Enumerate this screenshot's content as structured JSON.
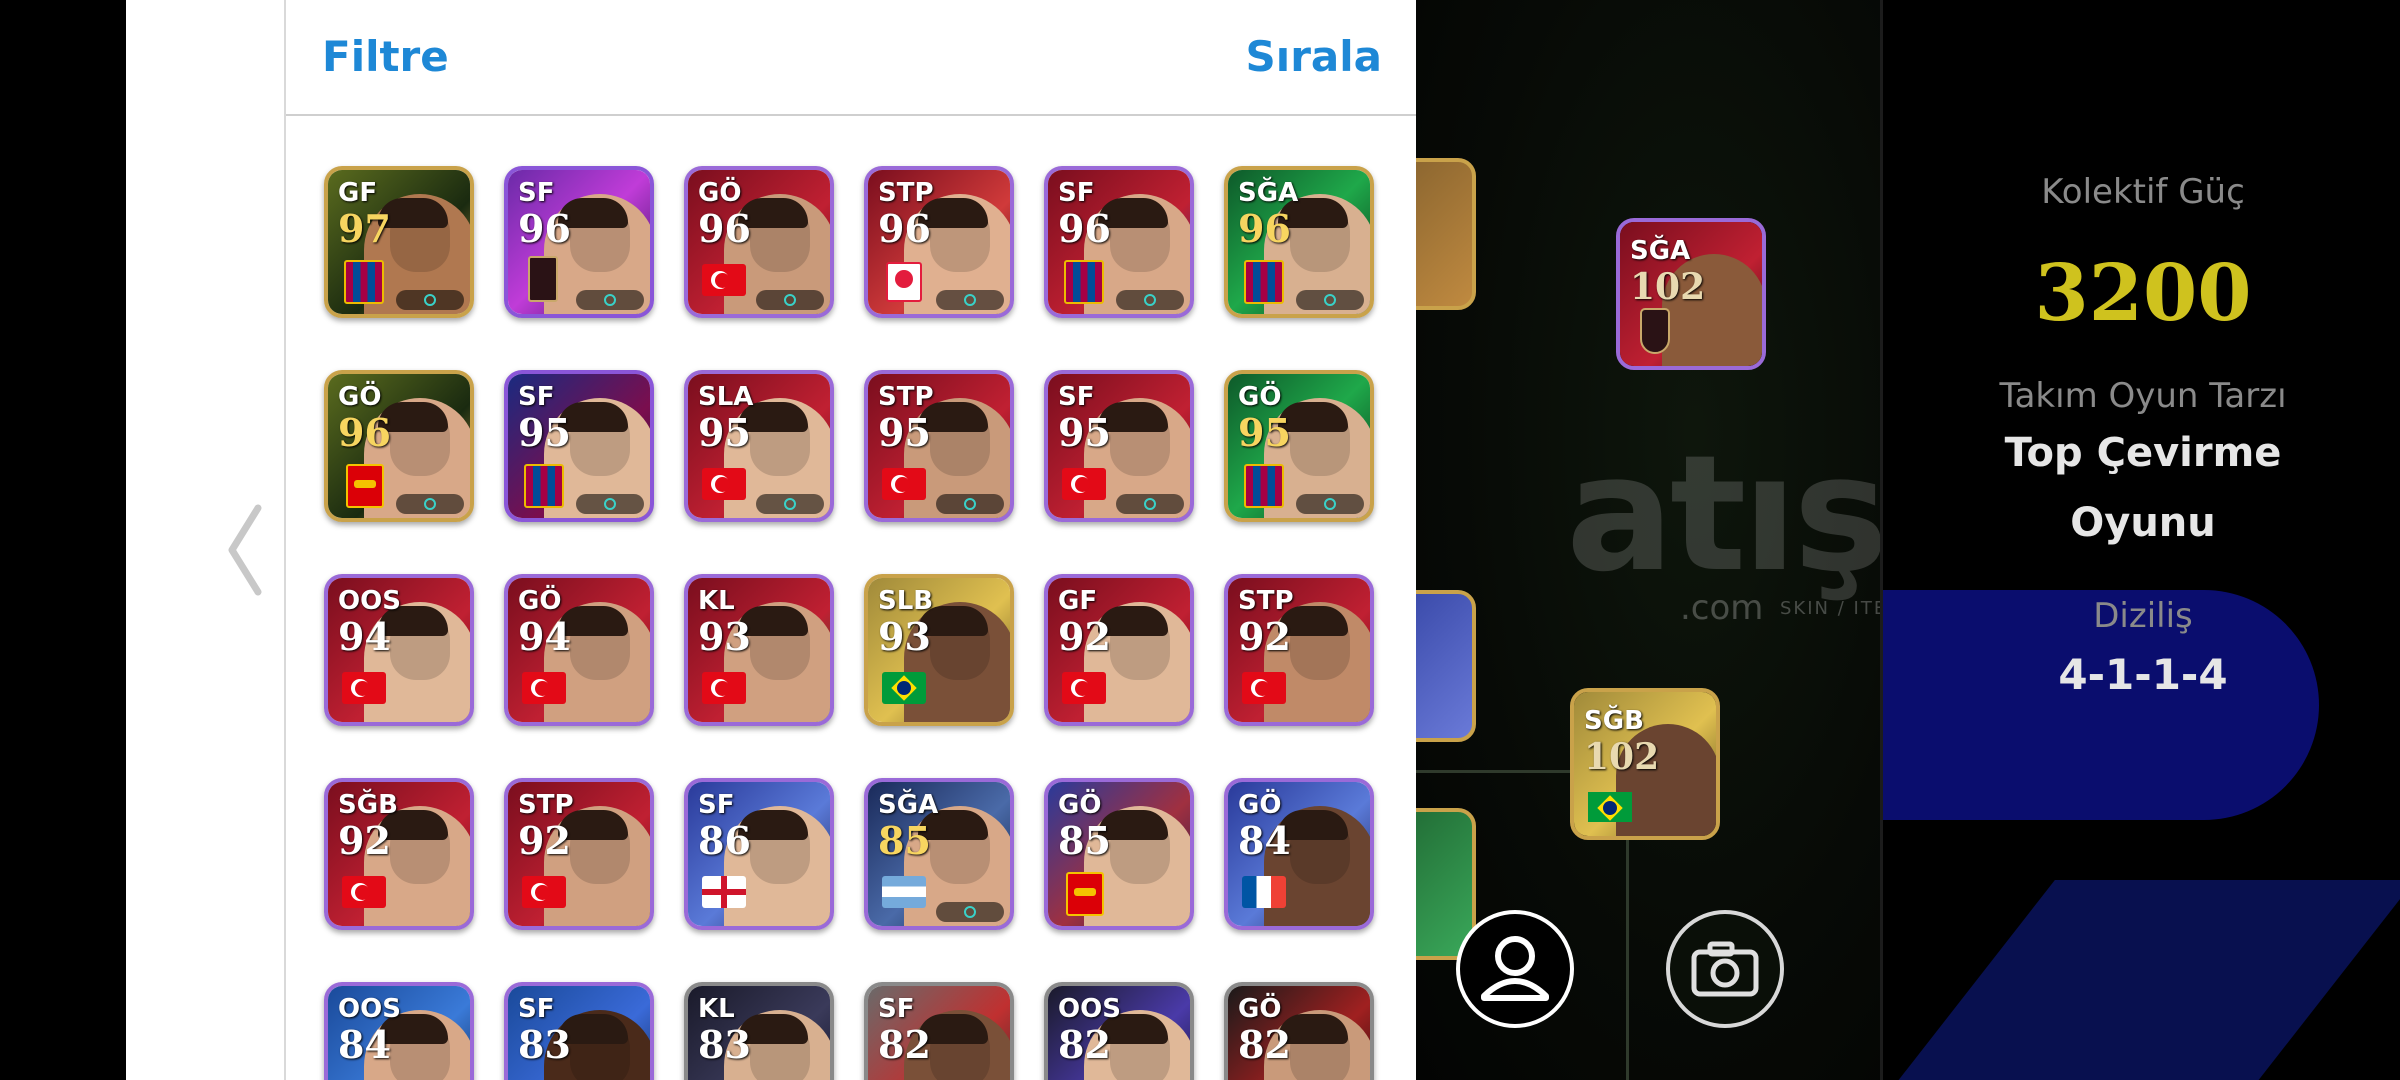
{
  "header": {
    "filter_label": "Filtre",
    "sort_label": "Sırala"
  },
  "players": [
    {
      "pos": "GF",
      "ovr": "97",
      "badge": "club-fcb",
      "bg": "linear-gradient(135deg,#5a6b1e,#1a2a10 60%,#c9a54a)",
      "skin": "#b07850",
      "border": "#c9a24a",
      "gold": true
    },
    {
      "pos": "SF",
      "ovr": "96",
      "badge": "club-dark",
      "bg": "linear-gradient(135deg,#6b2aa8,#c03cd8 50%,#2b0f55)",
      "skin": "#d8a888",
      "border": "#8a56d8",
      "gold": false
    },
    {
      "pos": "GÖ",
      "ovr": "96",
      "badge": "flag-tr",
      "bg": "linear-gradient(135deg,#7a0e1e,#c02032 60%,#5a0a14)",
      "skin": "#c99a7a",
      "border": "#9a6ad8",
      "gold": false
    },
    {
      "pos": "STP",
      "ovr": "96",
      "badge": "club-fen",
      "bg": "linear-gradient(135deg,#7a0e1e,#d03a3a 60%,#3a0a12)",
      "skin": "#e0b090",
      "border": "#9a6ad8",
      "gold": false
    },
    {
      "pos": "SF",
      "ovr": "96",
      "badge": "club-fcb",
      "bg": "linear-gradient(135deg,#7a0e1e,#c02032 60%,#1a2a80)",
      "skin": "#d8a888",
      "border": "#9a6ad8",
      "gold": false
    },
    {
      "pos": "SĞA",
      "ovr": "96",
      "badge": "club-fcb",
      "bg": "linear-gradient(135deg,#0e5a2a,#1fa84a 50%,#063015)",
      "skin": "#d8b090",
      "border": "#c9a24a",
      "gold": true
    },
    {
      "pos": "GÖ",
      "ovr": "96",
      "badge": "club-ars",
      "bg": "linear-gradient(135deg,#5a6b1e,#1a2a10 60%,#c9a54a)",
      "skin": "#d8a888",
      "border": "#c9a24a",
      "gold": true
    },
    {
      "pos": "SF",
      "ovr": "95",
      "badge": "club-fcb",
      "bg": "linear-gradient(135deg,#1a2a80,#7a0e4e 60%,#2a0a3a)",
      "skin": "#e0b898",
      "border": "#8a56d8",
      "gold": false
    },
    {
      "pos": "SLA",
      "ovr": "95",
      "badge": "flag-tr",
      "bg": "linear-gradient(135deg,#7a0e1e,#c02032 60%,#5a0a14)",
      "skin": "#e0b898",
      "border": "#9a6ad8",
      "gold": false
    },
    {
      "pos": "STP",
      "ovr": "95",
      "badge": "flag-tr",
      "bg": "linear-gradient(135deg,#7a0e1e,#c02032 60%,#5a0a14)",
      "skin": "#c99a7a",
      "border": "#9a6ad8",
      "gold": false
    },
    {
      "pos": "SF",
      "ovr": "95",
      "badge": "flag-tr",
      "bg": "linear-gradient(135deg,#7a0e1e,#c02032 60%,#5a0a14)",
      "skin": "#d8a888",
      "border": "#9a6ad8",
      "gold": false
    },
    {
      "pos": "GÖ",
      "ovr": "95",
      "badge": "club-fcb",
      "bg": "linear-gradient(135deg,#0e5a2a,#1fa84a 50%,#063015)",
      "skin": "#d8b090",
      "border": "#c9a24a",
      "gold": true
    },
    {
      "pos": "OOS",
      "ovr": "94",
      "badge": "flag-tr",
      "bg": "linear-gradient(135deg,#7a0e1e,#c02032 60%,#5a0a14)",
      "skin": "#e0b898",
      "border": "#9a6ad8",
      "gold": false
    },
    {
      "pos": "GÖ",
      "ovr": "94",
      "badge": "flag-tr",
      "bg": "linear-gradient(135deg,#7a0e1e,#c02032 60%,#5a0a14)",
      "skin": "#d0a080",
      "border": "#9a6ad8",
      "gold": false
    },
    {
      "pos": "KL",
      "ovr": "93",
      "badge": "flag-tr",
      "bg": "linear-gradient(135deg,#7a0e1e,#c02032 60%,#0e5a2a)",
      "skin": "#d0a080",
      "border": "#9a6ad8",
      "gold": false
    },
    {
      "pos": "SLB",
      "ovr": "93",
      "badge": "flag-br",
      "bg": "linear-gradient(135deg,#a08a3a,#e0c050 55%,#5a4a1a)",
      "skin": "#7a5038",
      "border": "#c9a24a",
      "gold": false
    },
    {
      "pos": "GF",
      "ovr": "92",
      "badge": "flag-tr",
      "bg": "linear-gradient(135deg,#7a0e1e,#c02032 60%,#5a0a14)",
      "skin": "#e0b898",
      "border": "#9a6ad8",
      "gold": false
    },
    {
      "pos": "STP",
      "ovr": "92",
      "badge": "flag-tr",
      "bg": "linear-gradient(135deg,#7a0e1e,#c02032 60%,#5a0a14)",
      "skin": "#c08a68",
      "border": "#9a6ad8",
      "gold": false
    },
    {
      "pos": "SĞB",
      "ovr": "92",
      "badge": "flag-tr",
      "bg": "linear-gradient(135deg,#7a0e1e,#c02032 60%,#5a0a14)",
      "skin": "#d8a888",
      "border": "#9a6ad8",
      "gold": false
    },
    {
      "pos": "STP",
      "ovr": "92",
      "badge": "flag-tr",
      "bg": "linear-gradient(135deg,#7a0e1e,#c02032 60%,#5a0a14)",
      "skin": "#d0a080",
      "border": "#9a6ad8",
      "gold": false
    },
    {
      "pos": "SF",
      "ovr": "86",
      "badge": "flag-en",
      "bg": "linear-gradient(135deg,#2a3a9a,#5a7ad8 55%,#1a1a4a)",
      "skin": "#e0b898",
      "border": "#9a6ad8",
      "gold": false
    },
    {
      "pos": "SĞA",
      "ovr": "85",
      "badge": "flag-ar",
      "bg": "linear-gradient(135deg,#1a2a5a,#4a6aa8 55%,#0a1a3a)",
      "skin": "#d8a888",
      "border": "#9a6ad8",
      "gold": true
    },
    {
      "pos": "GÖ",
      "ovr": "85",
      "badge": "club-ars",
      "bg": "linear-gradient(135deg,#2a3a9a,#a03040 55%,#1a1a4a)",
      "skin": "#e0b898",
      "border": "#9a6ad8",
      "gold": false
    },
    {
      "pos": "GÖ",
      "ovr": "84",
      "badge": "flag-fr",
      "bg": "linear-gradient(135deg,#2a3a9a,#5a7ad8 55%,#1a1a4a)",
      "skin": "#6a4430",
      "border": "#9a6ad8",
      "gold": false
    },
    {
      "pos": "OOS",
      "ovr": "84",
      "badge": "none",
      "bg": "linear-gradient(135deg,#1a4a9a,#3a7ad8 55%,#0a1a3a)",
      "skin": "#d8a888",
      "border": "#9a6ad8",
      "gold": false
    },
    {
      "pos": "SF",
      "ovr": "83",
      "badge": "none",
      "bg": "linear-gradient(135deg,#1a4a9a,#3a6ad8 55%,#0a1a3a)",
      "skin": "#4a2a1a",
      "border": "#9a6ad8",
      "gold": false
    },
    {
      "pos": "KL",
      "ovr": "83",
      "badge": "none",
      "bg": "linear-gradient(135deg,#1a1a2a,#3a3a5a 55%,#0a0a1a)",
      "skin": "#d8b090",
      "border": "#8a8a8a",
      "gold": false
    },
    {
      "pos": "SF",
      "ovr": "82",
      "badge": "none",
      "bg": "linear-gradient(135deg,#6a6a6a,#c03030 55%,#2a2a2a)",
      "skin": "#7a5038",
      "border": "#8a8a8a",
      "gold": false
    },
    {
      "pos": "OOS",
      "ovr": "82",
      "badge": "none",
      "bg": "linear-gradient(135deg,#1a1a2a,#4a3aa8 55%,#0a0a1a)",
      "skin": "#e0b898",
      "border": "#8a8a8a",
      "gold": false
    },
    {
      "pos": "GÖ",
      "ovr": "82",
      "badge": "none",
      "bg": "linear-gradient(135deg,#1a1a1a,#a02020 55%,#0a0a0a)",
      "skin": "#c99a7a",
      "border": "#8a8a8a",
      "gold": false
    }
  ],
  "pitch_cards": [
    {
      "pos": "SĞB",
      "ovr": "102",
      "badge": "flag-br",
      "bg": "linear-gradient(135deg,#a08a3a,#e0c050 55%,#5a4a1a)",
      "skin": "#6a4430"
    },
    {
      "pos": "SĞA",
      "ovr": "102",
      "badge": "club-dark",
      "bg": "linear-gradient(135deg,#7a0e1e,#c02032 60%,#3a0a12)",
      "skin": "#8a5a3a"
    }
  ],
  "watermark": {
    "main": "atış",
    "sub": "SKIN / ITEM / E-PIN",
    "suffix": ".com"
  },
  "stats": {
    "power_label": "Kolektif Güç",
    "power_value": "3200",
    "style_label": "Takım Oyun Tarzı",
    "style_value_line1": "Top Çevirme",
    "style_value_line2": "Oyunu",
    "formation_label": "Diziliş",
    "formation_value": "4-1-1-4"
  },
  "colors": {
    "accent": "#1e88d6",
    "power": "#cfc21e",
    "panel": "#ffffff",
    "formation_bg": "#0a0d6e"
  }
}
